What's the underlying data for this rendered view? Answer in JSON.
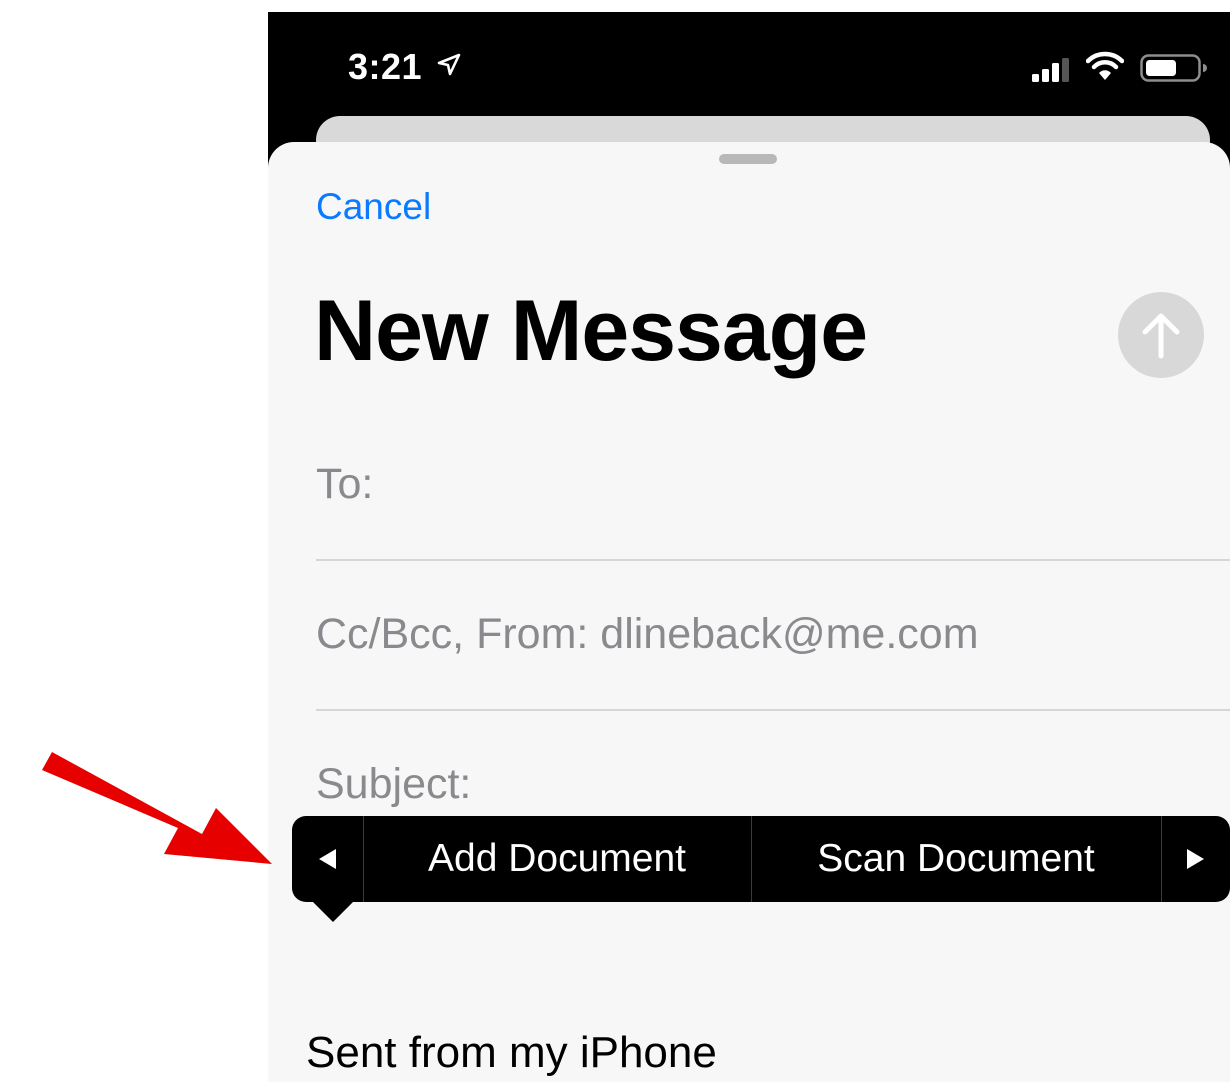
{
  "status_bar": {
    "time": "3:21",
    "icons": [
      "location-arrow-icon",
      "cellular-signal-icon",
      "wifi-icon",
      "battery-icon"
    ]
  },
  "compose": {
    "cancel_label": "Cancel",
    "title": "New Message",
    "send_icon": "arrow-up-icon",
    "to_label": "To:",
    "cc_from_label": "Cc/Bcc, From: dlineback@me.com",
    "subject_label": "Subject:",
    "signature": "Sent from my iPhone"
  },
  "callout_menu": {
    "prev_icon": "triangle-left-icon",
    "items": [
      "Add Document",
      "Scan Document"
    ],
    "next_icon": "triangle-right-icon"
  },
  "colors": {
    "accent": "#0a7aff",
    "annotation_arrow": "#e60000",
    "send_button_disabled": "#d8d8d8"
  }
}
